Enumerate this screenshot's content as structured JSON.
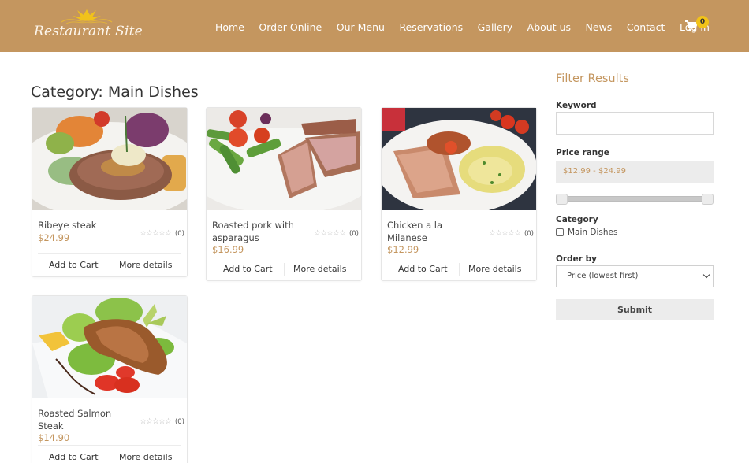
{
  "header": {
    "logo_text": "Restaurant Site",
    "brand_color": "#c4965f",
    "nav": [
      {
        "label": "Home"
      },
      {
        "label": "Order Online"
      },
      {
        "label": "Our Menu"
      },
      {
        "label": "Reservations"
      },
      {
        "label": "Gallery"
      },
      {
        "label": "About us"
      },
      {
        "label": "News"
      },
      {
        "label": "Contact"
      },
      {
        "label": "Log In"
      }
    ],
    "cart": {
      "icon": "shopping-cart-icon",
      "count": "0"
    }
  },
  "main": {
    "title": "Category: Main Dishes",
    "products": [
      {
        "name": "Ribeye steak",
        "price": "$24.99",
        "stars": "☆☆☆☆☆",
        "rating_count": "(0)",
        "add_label": "Add to Cart",
        "details_label": "More details",
        "image": "ribeye-steak-photo"
      },
      {
        "name": "Roasted pork with asparagus",
        "price": "$16.99",
        "stars": "☆☆☆☆☆",
        "rating_count": "(0)",
        "add_label": "Add to Cart",
        "details_label": "More details",
        "image": "roasted-pork-photo"
      },
      {
        "name": "Chicken a la Milanese",
        "price": "$12.99",
        "stars": "☆☆☆☆☆",
        "rating_count": "(0)",
        "add_label": "Add to Cart",
        "details_label": "More details",
        "image": "chicken-milanese-photo"
      },
      {
        "name": "Roasted Salmon Steak",
        "price": "$14.90",
        "stars": "☆☆☆☆☆",
        "rating_count": "(0)",
        "add_label": "Add to Cart",
        "details_label": "More details",
        "image": "roasted-salmon-photo"
      }
    ]
  },
  "sidebar": {
    "title": "Filter Results",
    "keyword": {
      "label": "Keyword",
      "value": "",
      "placeholder": ""
    },
    "price_range": {
      "label": "Price range",
      "display": "$12.99 - $24.99",
      "min": 12.99,
      "max": 24.99
    },
    "category": {
      "label": "Category",
      "option": "Main Dishes",
      "checked": false
    },
    "order_by": {
      "label": "Order by",
      "selected": "Price (lowest first)"
    },
    "submit_label": "Submit"
  }
}
